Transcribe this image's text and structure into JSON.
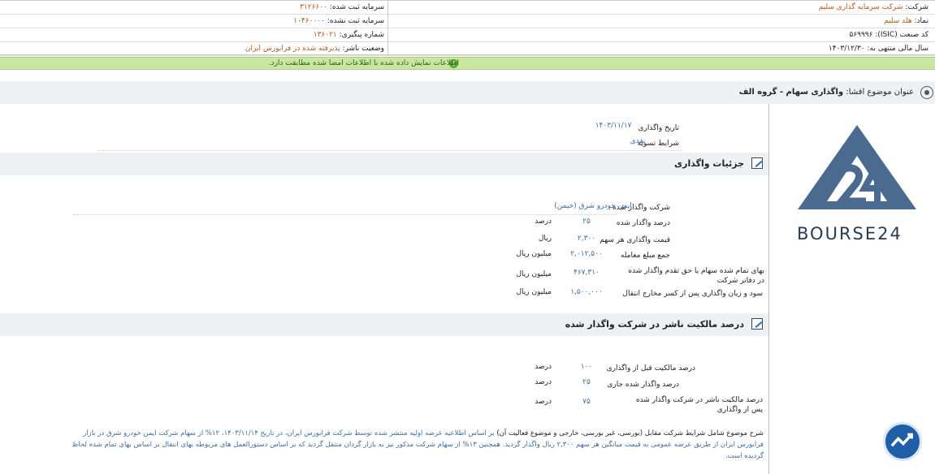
{
  "header": {
    "company_label": "شرکت:",
    "company_value": "شرکت سرمایه گذاری سلیم",
    "symbol_label": "نماد:",
    "symbol_value": "هلد سلیم",
    "isic_label": "کد صنعت (ISIC):",
    "isic_value": "۵۶۹۹۹۶",
    "fiscal_label": "سال مالی منتهی به:",
    "fiscal_value": "۱۴۰۳/۱۲/۳۰",
    "registered_capital_label": "سرمایه ثبت شده:",
    "registered_capital_value": "۳۱۲۶۶۰۰",
    "unregistered_capital_label": "سرمایه ثبت نشده:",
    "unregistered_capital_value": "۱۰۴۶۰۰۰۰",
    "tracking_label": "شماره پیگیری:",
    "tracking_value": "۱۳۶۰۲۱",
    "publisher_status_label": "وضعیت ناشر:",
    "publisher_status_value": "پذیرفته شده در فرابورس ایران"
  },
  "notice": {
    "text": "اطلاعات نمایش داده شده با اطلاعات امضا شده مطابقت دارد.",
    "icon": "info-icon",
    "color": "#c9e7a3"
  },
  "title": {
    "label": "عنوان موضوع افشا:",
    "value": "واگذاری سهام - گروه الف"
  },
  "transfer": {
    "date_label": "تاریخ واگذاری",
    "date_value": "۱۴۰۳/۱۱/۱۷",
    "settlement_label": "شرایط تسویه",
    "settlement_value": "نقدی"
  },
  "details": {
    "section_title": "جزئیات واگذاری",
    "rows": [
      {
        "label": "شرکت واگذار شده",
        "value": "ایمن خودرو شرق (خیمن)",
        "unit": ""
      },
      {
        "label": "درصد واگذار شده",
        "value": "۲۵",
        "unit": "درصد"
      },
      {
        "label": "قیمت واگذاری هر سهم",
        "value": "۲,۳۰۰",
        "unit": "ریال"
      },
      {
        "label": "جمع مبلغ معامله",
        "value": "۲,۰۱۲,۵۰۰",
        "unit": "میلیون ریال"
      },
      {
        "label": "بهای تمام شده سهام یا حق تقدم واگذار شده در دفاتر شرکت",
        "value": "۴۶۷,۳۱۰",
        "unit": "میلیون ریال"
      },
      {
        "label": "سود و زیان واگذاری پس از کسر مخارج انتقال",
        "value": "۱,۵۰۰,۰۰۰",
        "unit": "میلیون ریال"
      }
    ]
  },
  "ownership": {
    "section_title": "درصد مالکیت ناشر در شرکت واگذار شده",
    "rows": [
      {
        "label": "درصد مالکیت قبل از واگذاری",
        "value": "۱۰۰",
        "unit": "درصد"
      },
      {
        "label": "درصد واگذار شده جاری",
        "value": "۲۵",
        "unit": "درصد"
      },
      {
        "label": "درصد مالکیت ناشر در شرکت واگذار شده پس از واگذاری",
        "value": "۷۵",
        "unit": "درصد"
      }
    ]
  },
  "description": {
    "label": "شرح موضوع شامل شرایط شرکت مقابل (بورسی، غیر بورسی، خارجی و موضوع فعالیت آن)",
    "text": "بر اساس اطلاعیه عرضه اولیه منتشر شده توسط شرکت فرابورس ایران، در تاریخ ۱۴۰۳/۱۱/۱۴، ۱۲% از سهام شرکت ایمن خودرو شرق در بازار فرابورس ایران از طریق عرضه عمومی به قیمت میانگین هر سهم ۲,۳۰۰ ریال واگذار گردید. همچنین ۱۳% از سهام شرکت مذکور نیز به بازار گردان منتقل گردید که بر اساس دستورالعمل های مربوطه بهای انتقال بر اساس بهای تمام شده لحاظ گردیده است."
  },
  "logo": {
    "text": "BOURSE24",
    "color": "#4a6a8f"
  }
}
